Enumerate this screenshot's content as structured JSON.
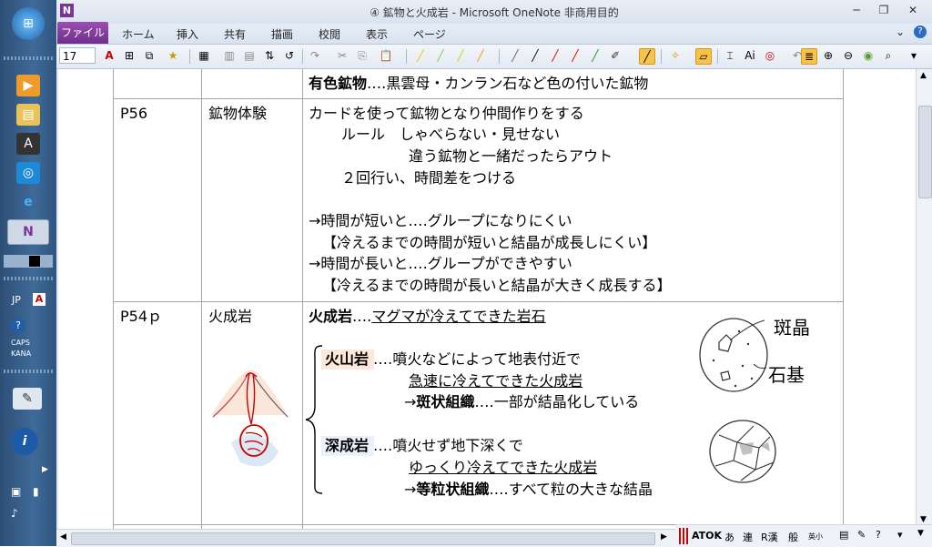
{
  "window": {
    "title": "④ 鉱物と火成岩 - Microsoft OneNote 非商用目的",
    "app_badge": "N"
  },
  "ribbon": {
    "file_tab": "ファイル",
    "tabs": [
      "ホーム",
      "挿入",
      "共有",
      "描画",
      "校閲",
      "表示",
      "ページ"
    ]
  },
  "toolbar": {
    "font_size": "17"
  },
  "taskbar": {
    "lang": "JP",
    "caps": "CAPS",
    "kana": "KANA"
  },
  "ime_bar": {
    "items": [
      "ATOK",
      "あ",
      "連",
      "R漢",
      "般",
      "英小"
    ]
  },
  "table": {
    "row0": {
      "text_bold": "有色鉱物",
      "text_rest": "‥‥黒雲母・カンラン石など色の付いた鉱物"
    },
    "row1": {
      "page": "P56",
      "topic": "鉱物体験",
      "lines": [
        "カードを使って鉱物となり仲間作りをする",
        "ルール　しゃべらない・見せない",
        "違う鉱物と一緒だったらアウト",
        "２回行い、時間差をつける",
        "→時間が短いと‥‥グループになりにくい",
        "【冷えるまでの時間が短いと結晶が成長しにくい】",
        "→時間が長いと‥‥グループができやすい",
        "【冷えるまでの時間が長いと結晶が大きく成長する】"
      ]
    },
    "row2": {
      "page": "P54ｐ",
      "topic": "火成岩",
      "title_bold": "火成岩",
      "title_sep": "‥‥",
      "title_def": "マグマが冷えてできた岩石",
      "volcanic": {
        "name": "火山岩",
        "line1": "‥‥噴火などによって地表付近で",
        "line2": "急速に冷えてできた火成岩",
        "arrow": "→",
        "texture": "斑状組織",
        "desc": "‥‥一部が結晶化している"
      },
      "plutonic": {
        "name": "深成岩",
        "line1": "‥‥噴火せず地下深くで",
        "line2": "ゆっくり冷えてできた火成岩",
        "arrow": "→",
        "texture": "等粒状組織",
        "desc": "‥‥すべて粒の大きな結晶"
      },
      "sketch_label_phenocryst": "斑晶",
      "sketch_label_groundmass": "石基"
    }
  },
  "colors": {
    "file_tab": "#7b3596",
    "grid": "#a6a6a6",
    "highlight": "#fde9d9"
  }
}
